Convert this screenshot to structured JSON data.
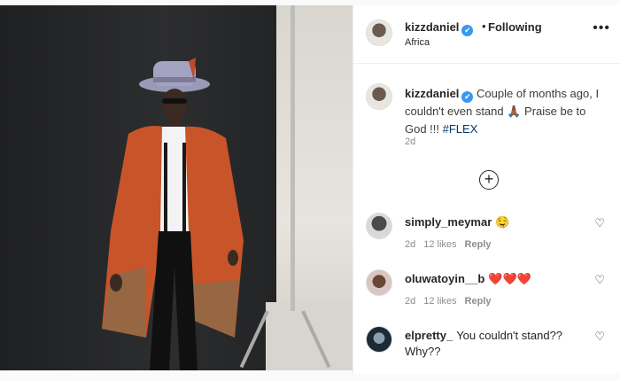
{
  "post": {
    "username": "kizzdaniel",
    "verified_mark": "✔",
    "separator": "•",
    "follow_status": "Following",
    "location": "Africa",
    "more_icon": "•••"
  },
  "caption": {
    "username": "kizzdaniel",
    "text": "Couple of months ago, I couldn't even stand 🙏🏾 Praise be to God !!! ",
    "hashtag": "#FLEX",
    "time": "2d"
  },
  "load_more_icon": "+",
  "comments": [
    {
      "username": "simply_meymar",
      "text": "🤤",
      "time": "2d",
      "likes": "12 likes",
      "reply": "Reply"
    },
    {
      "username": "oluwatoyin__b",
      "text": "❤️❤️❤️",
      "time": "2d",
      "likes": "12 likes",
      "reply": "Reply"
    },
    {
      "username": "elpretty_",
      "text": "You couldn't stand?? Why??",
      "time": "",
      "likes": "",
      "reply": ""
    }
  ],
  "heart_icon": "♡",
  "colors": {
    "verified": "#3897f0",
    "hashtag": "#00376b",
    "muted": "#8e8e8e"
  }
}
